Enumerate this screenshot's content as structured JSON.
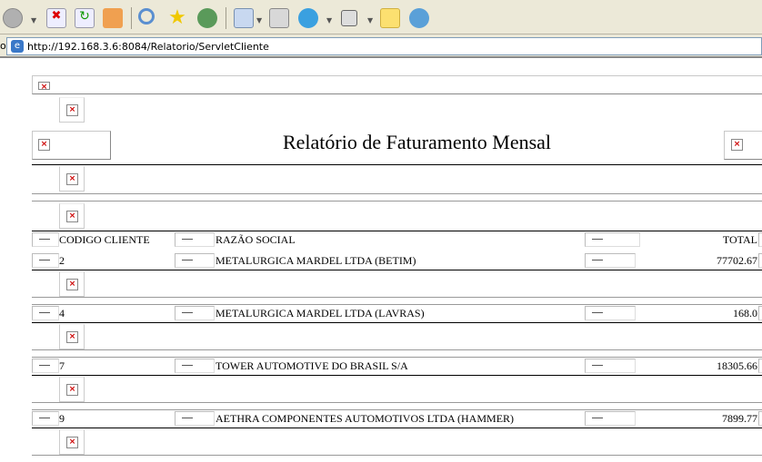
{
  "browser": {
    "address_label": "o",
    "url": "http://192.168.3.6:8084/Relatorio/ServletCliente",
    "toolbar_icons": [
      "back-icon",
      "stop-icon",
      "refresh-icon",
      "home-icon",
      "search-icon",
      "favorites-icon",
      "history-icon",
      "mail-icon",
      "print-icon",
      "skype-icon",
      "word-icon",
      "notes-icon",
      "messenger-icon"
    ]
  },
  "report": {
    "title": "Relatório de Faturamento Mensal",
    "headers": {
      "code": "CODIGO CLIENTE",
      "name": "RAZÃO SOCIAL",
      "total": "TOTAL"
    },
    "rows": [
      {
        "code": "2",
        "name": "METALURGICA MARDEL LTDA (BETIM)",
        "total": "77702.67"
      },
      {
        "code": "4",
        "name": "METALURGICA MARDEL LTDA (LAVRAS)",
        "total": "168.0"
      },
      {
        "code": "7",
        "name": "TOWER AUTOMOTIVE DO BRASIL S/A",
        "total": "18305.66"
      },
      {
        "code": "9",
        "name": "AETHRA COMPONENTES AUTOMOTIVOS LTDA (HAMMER)",
        "total": "7899.77"
      }
    ]
  }
}
